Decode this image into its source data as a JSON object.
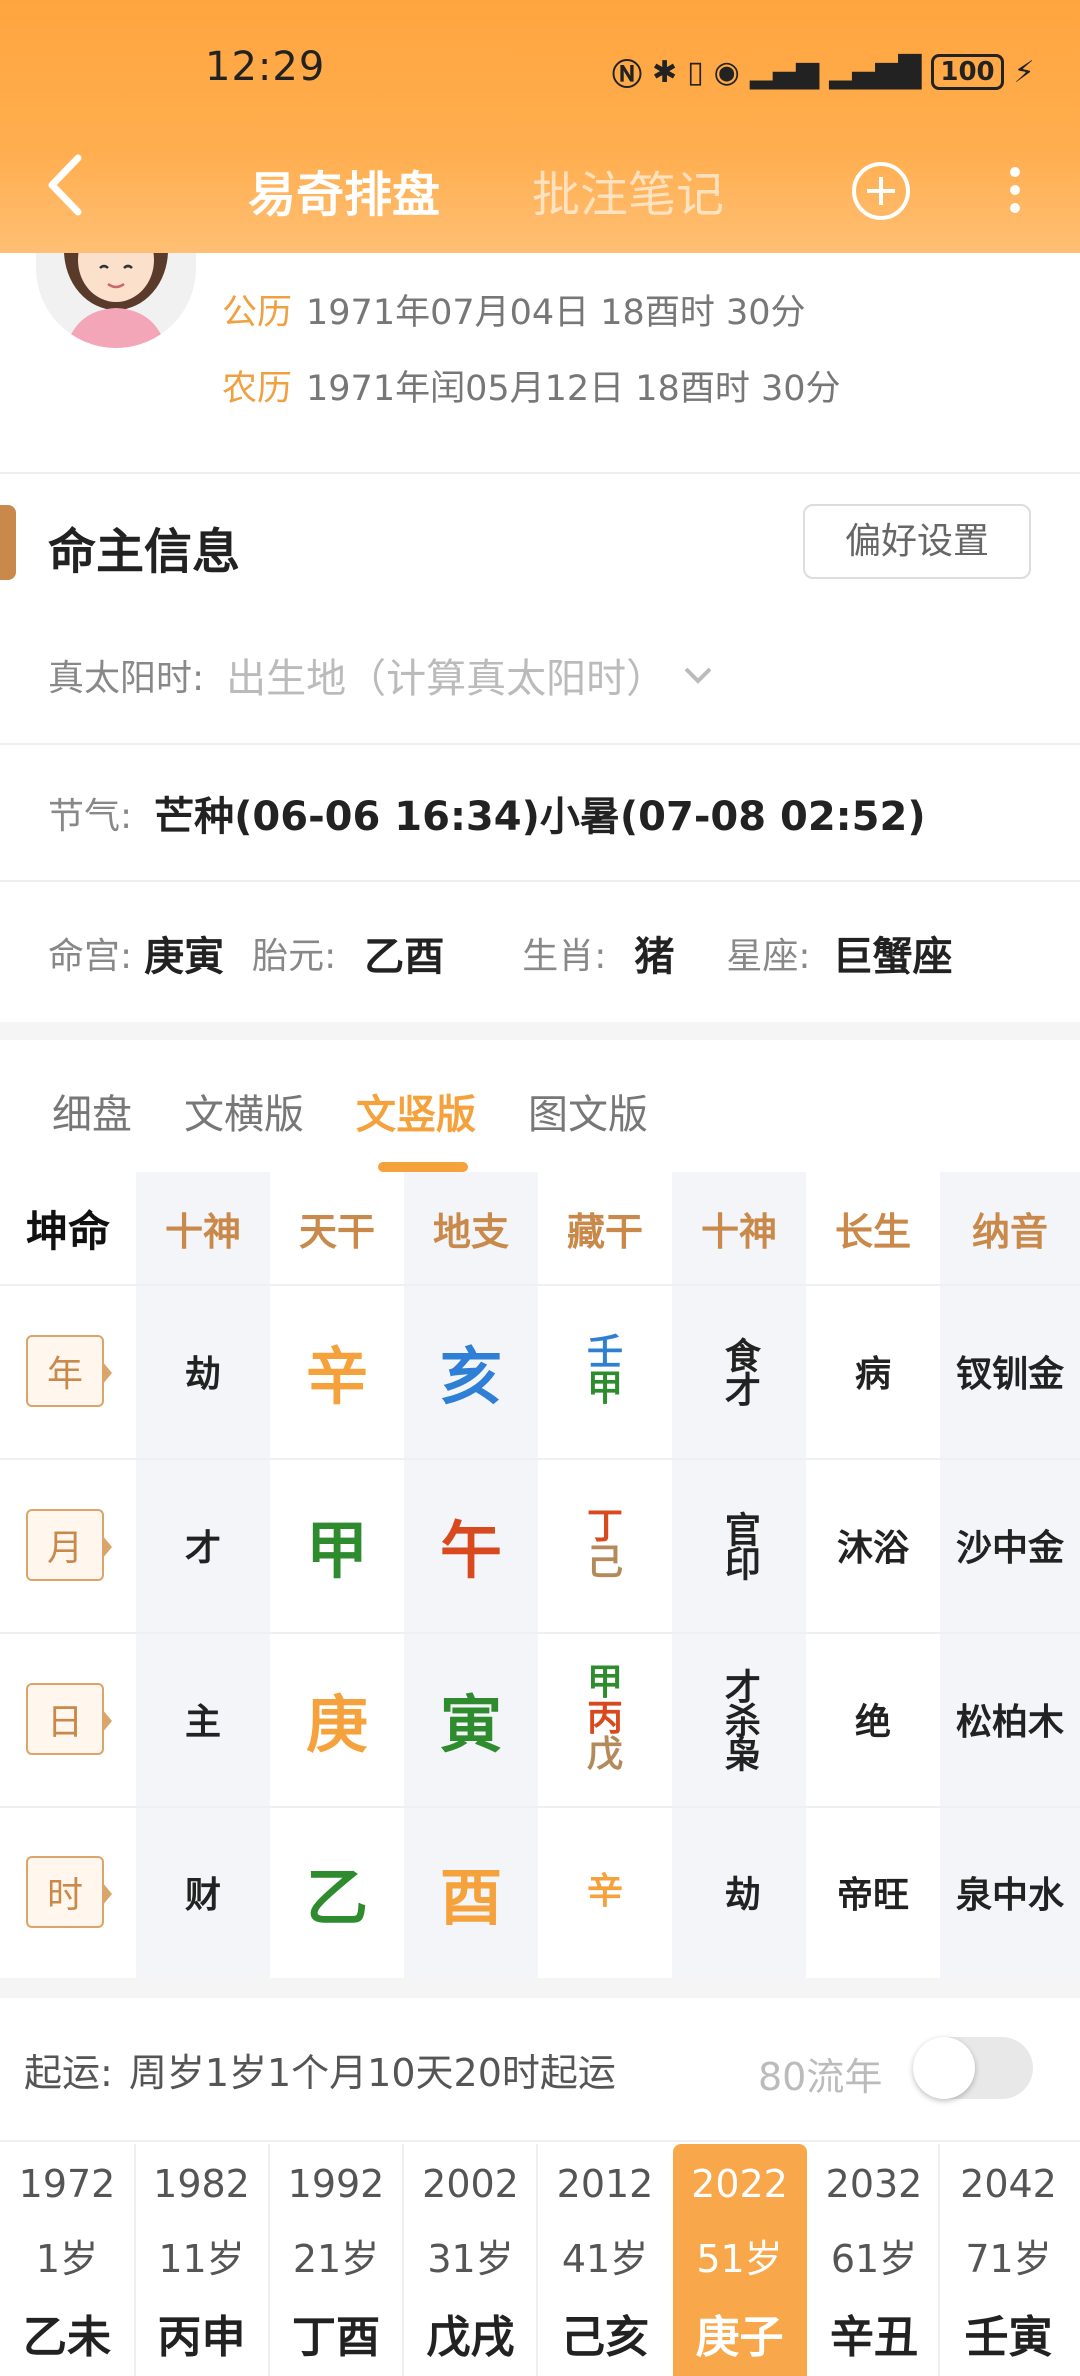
{
  "status_bar": {
    "time": "12:29",
    "battery": "100"
  },
  "header": {
    "tab_active": "易奇排盘",
    "tab_inactive": "批注笔记"
  },
  "calendar": {
    "solar_label": "公历",
    "solar_value": "1971年07月04日 18酉时 30分",
    "lunar_label": "农历",
    "lunar_value": "1971年闰05月12日 18酉时 30分"
  },
  "section": {
    "title": "命主信息",
    "pref_button": "偏好设置"
  },
  "true_solar": {
    "label": "真太阳时:",
    "placeholder": "出生地（计算真太阳时）"
  },
  "solar_terms": {
    "label": "节气:",
    "value": "芒种(06-06 16:34)小暑(07-08 02:52)"
  },
  "info": {
    "minggong_label": "命宫:",
    "minggong": "庚寅",
    "taiyuan_label": "胎元:",
    "taiyuan": "乙酉",
    "zodiac_label": "生肖:",
    "zodiac": "猪",
    "star_label": "星座:",
    "star": "巨蟹座"
  },
  "view_tabs": [
    "细盘",
    "文横版",
    "文竖版",
    "图文版"
  ],
  "active_view_tab": 2,
  "table": {
    "corner": "坤命",
    "headers": [
      "十神",
      "天干",
      "地支",
      "藏干",
      "十神",
      "长生",
      "纳音"
    ],
    "rows": [
      {
        "pillar": "年",
        "shishen": "劫",
        "gan": "辛",
        "zhi": "亥",
        "canggan": [
          "壬",
          "甲"
        ],
        "shishen2": "食才",
        "changsheng": "病",
        "nayin": "钗钏金"
      },
      {
        "pillar": "月",
        "shishen": "才",
        "gan": "甲",
        "zhi": "午",
        "canggan": [
          "丁",
          "己"
        ],
        "shishen2": "官印",
        "changsheng": "沐浴",
        "nayin": "沙中金"
      },
      {
        "pillar": "日",
        "shishen": "主",
        "gan": "庚",
        "zhi": "寅",
        "canggan": [
          "甲",
          "丙",
          "戊"
        ],
        "shishen2": "才杀枭",
        "changsheng": "绝",
        "nayin": "松柏木"
      },
      {
        "pillar": "时",
        "shishen": "财",
        "gan": "乙",
        "zhi": "酉",
        "canggan": [
          "辛"
        ],
        "shishen2": "劫",
        "changsheng": "帝旺",
        "nayin": "泉中水"
      }
    ]
  },
  "element_colors": {
    "metal": "#f5a23c",
    "wood": "#2e8b2e",
    "water": "#2f7fd6",
    "fire": "#d8491e",
    "earth": "#b48a5a"
  },
  "qiyun": {
    "label": "起运:",
    "value": "周岁1岁1个月10天20时起运",
    "liunian_label": "80流年",
    "liunian_on": false
  },
  "dayun": [
    {
      "year": "1972",
      "age": "1岁",
      "ganzhi": "乙未"
    },
    {
      "year": "1982",
      "age": "11岁",
      "ganzhi": "丙申"
    },
    {
      "year": "1992",
      "age": "21岁",
      "ganzhi": "丁酉"
    },
    {
      "year": "2002",
      "age": "31岁",
      "ganzhi": "戊戌"
    },
    {
      "year": "2012",
      "age": "41岁",
      "ganzhi": "己亥"
    },
    {
      "year": "2022",
      "age": "51岁",
      "ganzhi": "庚子",
      "selected": true
    },
    {
      "year": "2032",
      "age": "61岁",
      "ganzhi": "辛丑"
    },
    {
      "year": "2042",
      "age": "71岁",
      "ganzhi": "壬寅"
    }
  ]
}
